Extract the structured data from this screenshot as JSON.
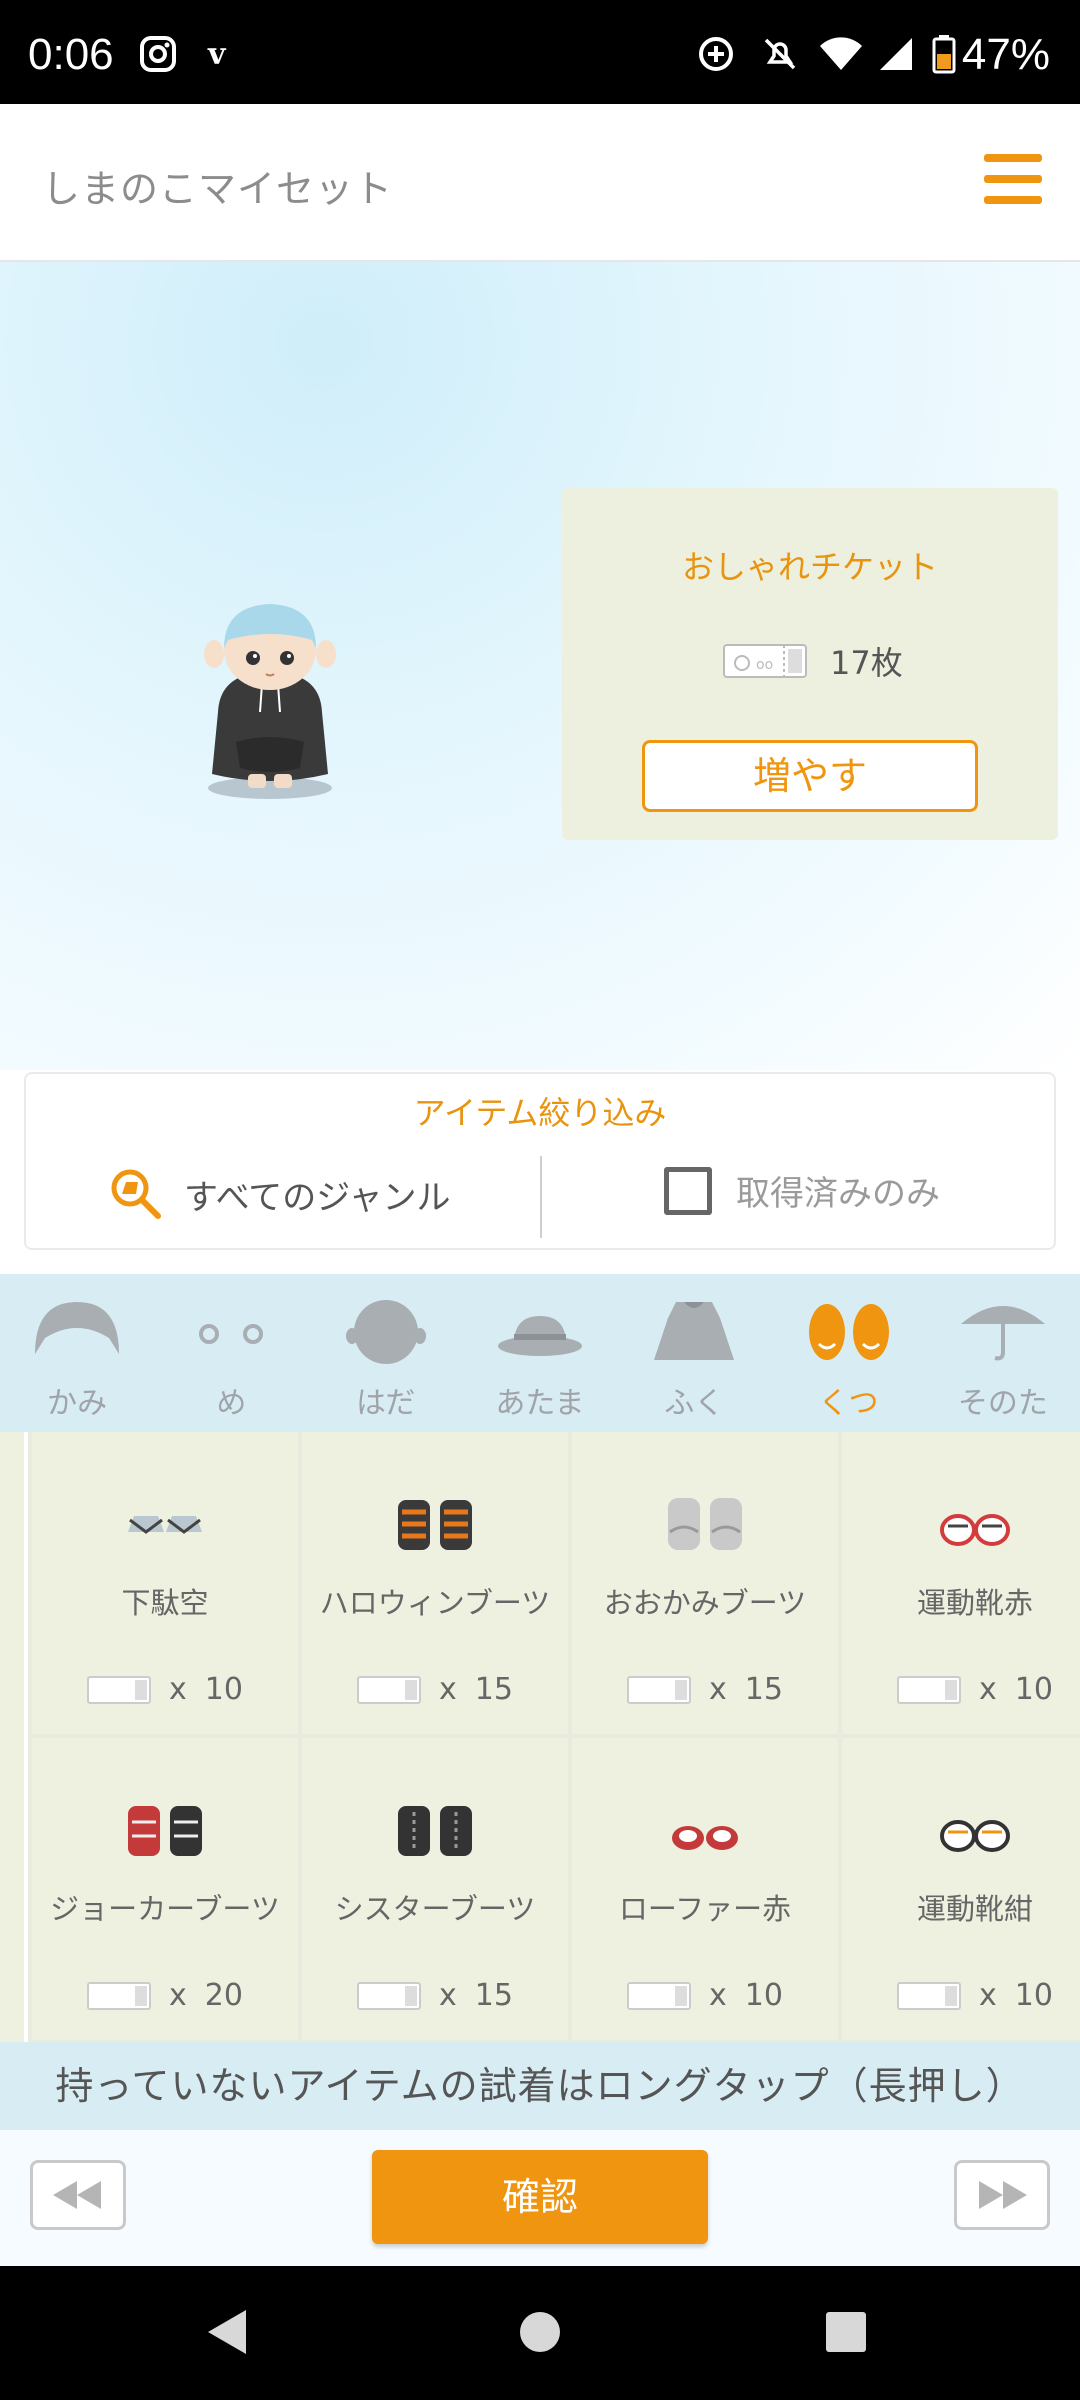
{
  "status_bar": {
    "time": "0:06",
    "battery": "47%",
    "icons": [
      "instagram-icon",
      "v-icon",
      "data-saver-icon",
      "mute-icon",
      "wifi-icon",
      "signal-icon",
      "battery-icon"
    ]
  },
  "app_header": {
    "title": "しまのこマイセット",
    "menu_icon": "hamburger-icon"
  },
  "ticket_card": {
    "title": "おしゃれチケット",
    "count": "17枚",
    "increase_label": "増やす"
  },
  "filter": {
    "title": "アイテム絞り込み",
    "genre_label": "すべてのジャンル",
    "owned_only_label": "取得済みのみ"
  },
  "categories": [
    {
      "label": "かみ",
      "icon": "hair-icon"
    },
    {
      "label": "め",
      "icon": "eyes-icon"
    },
    {
      "label": "はだ",
      "icon": "skin-icon"
    },
    {
      "label": "あたま",
      "icon": "hat-icon"
    },
    {
      "label": "ふく",
      "icon": "clothes-icon"
    },
    {
      "label": "くつ",
      "icon": "shoes-icon",
      "active": true
    },
    {
      "label": "そのた",
      "icon": "umbrella-icon"
    }
  ],
  "items": [
    {
      "name": "下駄空",
      "price": "10"
    },
    {
      "name": "ハロウィンブーツ",
      "price": "15"
    },
    {
      "name": "おおかみブーツ",
      "price": "15"
    },
    {
      "name": "運動靴赤",
      "price": "10"
    },
    {
      "name": "ジョーカーブーツ",
      "price": "20"
    },
    {
      "name": "シスターブーツ",
      "price": "15"
    },
    {
      "name": "ローファー赤",
      "price": "10"
    },
    {
      "name": "運動靴紺",
      "price": "10"
    }
  ],
  "price_prefix": "x",
  "notice": "持っていないアイテムの試着はロングタップ（長押し）",
  "controls": {
    "confirm_label": "確認"
  },
  "colors": {
    "accent": "#f0950f",
    "card_bg": "#eef0df",
    "tab_bg": "#d8ecf4"
  }
}
